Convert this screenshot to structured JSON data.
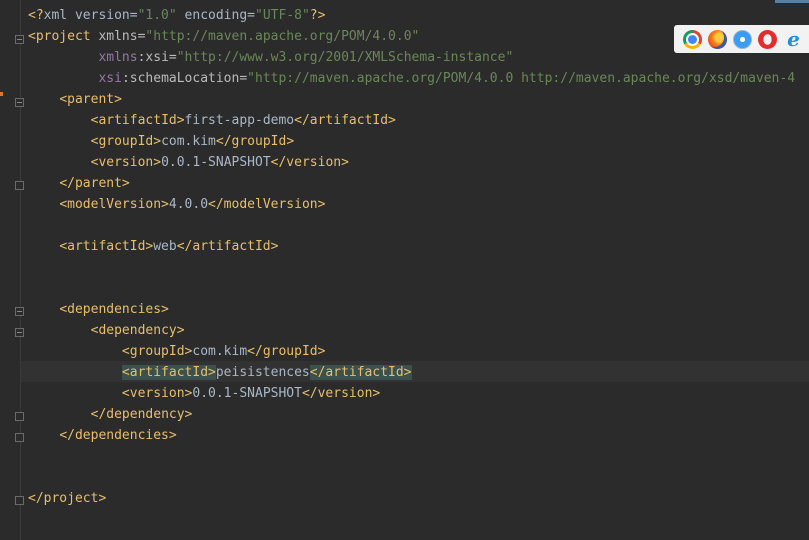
{
  "editor": {
    "lines": [
      [
        [
          "t-tag",
          "<?"
        ],
        [
          "t-text",
          "xml version="
        ],
        [
          "t-val",
          "\"1.0\""
        ],
        [
          "t-text",
          " encoding="
        ],
        [
          "t-val",
          "\"UTF-8\""
        ],
        [
          "t-tag",
          "?>"
        ]
      ],
      [
        [
          "t-tag",
          "<project "
        ],
        [
          "t-attr",
          "xmlns="
        ],
        [
          "t-val",
          "\"http://maven.apache.org/POM/4.0.0\""
        ]
      ],
      [
        [
          "t-text",
          "         "
        ],
        [
          "t-ns",
          "xmlns"
        ],
        [
          "t-attr",
          ":xsi="
        ],
        [
          "t-val",
          "\"http://www.w3.org/2001/XMLSchema-instance\""
        ]
      ],
      [
        [
          "t-text",
          "         "
        ],
        [
          "t-ns",
          "xsi"
        ],
        [
          "t-attr",
          ":schemaLocation="
        ],
        [
          "t-val",
          "\"http://maven.apache.org/POM/4.0.0 http://maven.apache.org/xsd/maven-4"
        ]
      ],
      [
        [
          "t-text",
          "    "
        ],
        [
          "t-tag",
          "<parent>"
        ]
      ],
      [
        [
          "t-text",
          "        "
        ],
        [
          "t-tag",
          "<artifactId>"
        ],
        [
          "t-text",
          "first-app-demo"
        ],
        [
          "t-tag",
          "</artifactId>"
        ]
      ],
      [
        [
          "t-text",
          "        "
        ],
        [
          "t-tag",
          "<groupId>"
        ],
        [
          "t-text",
          "com.kim"
        ],
        [
          "t-tag",
          "</groupId>"
        ]
      ],
      [
        [
          "t-text",
          "        "
        ],
        [
          "t-tag",
          "<version>"
        ],
        [
          "t-text",
          "0.0.1-SNAPSHOT"
        ],
        [
          "t-tag",
          "</version>"
        ]
      ],
      [
        [
          "t-text",
          "    "
        ],
        [
          "t-tag",
          "</parent>"
        ]
      ],
      [
        [
          "t-text",
          "    "
        ],
        [
          "t-tag",
          "<modelVersion>"
        ],
        [
          "t-text",
          "4.0.0"
        ],
        [
          "t-tag",
          "</modelVersion>"
        ]
      ],
      [],
      [
        [
          "t-text",
          "    "
        ],
        [
          "t-tag",
          "<artifactId>"
        ],
        [
          "t-text",
          "web"
        ],
        [
          "t-tag",
          "</artifactId>"
        ]
      ],
      [],
      [],
      [
        [
          "t-text",
          "    "
        ],
        [
          "t-tag",
          "<dependencies>"
        ]
      ],
      [
        [
          "t-text",
          "        "
        ],
        [
          "t-tag",
          "<dependency>"
        ]
      ],
      [
        [
          "t-text",
          "            "
        ],
        [
          "t-tag",
          "<groupId>"
        ],
        [
          "t-text",
          "com.kim"
        ],
        [
          "t-tag",
          "</groupId>"
        ]
      ],
      [
        [
          "t-text",
          "            "
        ],
        [
          "t-tag t-hl",
          "<artifactId>"
        ],
        [
          "t-text",
          "peisistences"
        ],
        [
          "t-tag t-hl",
          "</artifactId>"
        ]
      ],
      [
        [
          "t-text",
          "            "
        ],
        [
          "t-tag",
          "<version>"
        ],
        [
          "t-text",
          "0.0.1-SNAPSHOT"
        ],
        [
          "t-tag",
          "</version>"
        ]
      ],
      [
        [
          "t-text",
          "        "
        ],
        [
          "t-tag",
          "</dependency>"
        ]
      ],
      [
        [
          "t-text",
          "    "
        ],
        [
          "t-tag",
          "</dependencies>"
        ]
      ],
      [],
      [],
      [
        [
          "t-tag",
          "</project>"
        ]
      ]
    ]
  },
  "browser_toolbar": {
    "icons": [
      "chrome-icon",
      "firefox-icon",
      "safari-icon",
      "opera-icon",
      "ie-icon"
    ],
    "ie_glyph": "e"
  },
  "colors": {
    "background": "#2b2b2b",
    "tag": "#e8bf6a",
    "attribute": "#bababa",
    "namespace": "#9876aa",
    "string": "#6a8759",
    "text": "#a9b7c6",
    "match_highlight": "#3b514d"
  }
}
